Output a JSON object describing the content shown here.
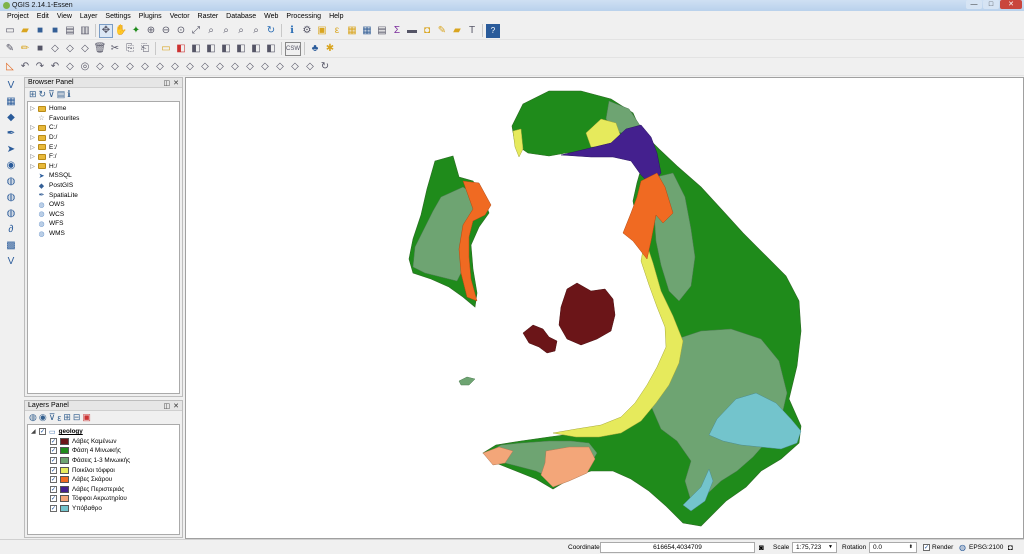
{
  "window": {
    "title": "QGIS 2.14.1-Essen",
    "controls": [
      "—",
      "□",
      "✕"
    ]
  },
  "menu": [
    "Project",
    "Edit",
    "View",
    "Layer",
    "Settings",
    "Plugins",
    "Vector",
    "Raster",
    "Database",
    "Web",
    "Processing",
    "Help"
  ],
  "toolbar": {
    "csw_label": "CSW"
  },
  "browser": {
    "title": "Browser Panel",
    "items": [
      "Home",
      "Favourites",
      "C:/",
      "D:/",
      "E:/",
      "F:/",
      "H:/",
      "MSSQL",
      "PostGIS",
      "SpatiaLite",
      "OWS",
      "WCS",
      "WFS",
      "WMS"
    ]
  },
  "layers": {
    "title": "Layers Panel",
    "group": "geology",
    "items": [
      {
        "label": "Λάβες Καμένων",
        "color": "#6b1518"
      },
      {
        "label": "Φάση 4 Μινωικής",
        "color": "#1f8b1b"
      },
      {
        "label": "Φάσεις 1-3 Μινωικής",
        "color": "#6ea472"
      },
      {
        "label": "Ποικίλοι τόφφοι",
        "color": "#e6ea5c"
      },
      {
        "label": "Λάβες Σκάρου",
        "color": "#f06a22"
      },
      {
        "label": "Λάβες Περιστεριάς",
        "color": "#44208e"
      },
      {
        "label": "Τόφφοι Ακρωτηρίου",
        "color": "#f3a679"
      },
      {
        "label": "Υπόβαθρο",
        "color": "#73c4cc"
      }
    ]
  },
  "status": {
    "coordinate_label": "Coordinate",
    "coordinate_value": "616654,4034709",
    "scale_label": "Scale",
    "scale_value": "1:75,723",
    "rotation_label": "Rotation",
    "rotation_value": "0.0",
    "render_label": "Render",
    "crs": "EPSG:2100"
  }
}
